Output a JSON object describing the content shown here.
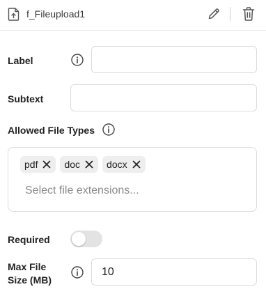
{
  "header": {
    "title": "f_Fileupload1",
    "file_icon": "file-upload-icon",
    "edit_icon": "pencil-icon",
    "delete_icon": "trash-icon"
  },
  "fields": {
    "label": {
      "label": "Label",
      "value": "",
      "info_icon": "info-icon"
    },
    "subtext": {
      "label": "Subtext",
      "value": ""
    },
    "allowed_types": {
      "label": "Allowed File Types",
      "info_icon": "info-icon",
      "chips": [
        "pdf",
        "doc",
        "docx"
      ],
      "placeholder": "Select file extensions..."
    },
    "required": {
      "label": "Required",
      "enabled": false
    },
    "max_size": {
      "label_line1": "Max File",
      "label_line2": "Size (MB)",
      "value": "10",
      "info_icon": "info-icon"
    }
  }
}
